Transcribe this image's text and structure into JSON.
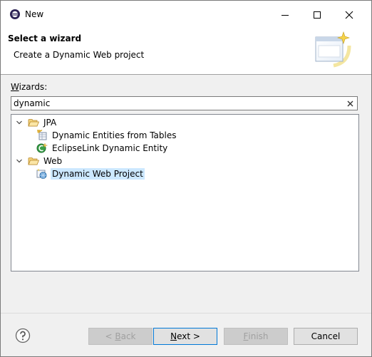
{
  "window": {
    "title": "New"
  },
  "banner": {
    "title": "Select a wizard",
    "description": "Create a Dynamic Web project"
  },
  "wizards": {
    "label_underlined": "W",
    "label_rest": "izards:",
    "filter_value": "dynamic"
  },
  "tree": {
    "groups": [
      {
        "label": "JPA",
        "expanded": true,
        "items": [
          {
            "label": "Dynamic Entities from Tables"
          },
          {
            "label": "EclipseLink Dynamic Entity"
          }
        ]
      },
      {
        "label": "Web",
        "expanded": true,
        "items": [
          {
            "label": "Dynamic Web Project",
            "selected": true
          }
        ]
      }
    ]
  },
  "buttons": {
    "back_prefix": "< ",
    "back_mnemonic": "B",
    "back_rest": "ack",
    "next_mnemonic": "N",
    "next_rest": "ext >",
    "finish_mnemonic": "F",
    "finish_rest": "inish",
    "cancel": "Cancel"
  },
  "colors": {
    "selection": "#cce8ff",
    "folder": "#e8b94a",
    "accent": "#0078d7"
  }
}
